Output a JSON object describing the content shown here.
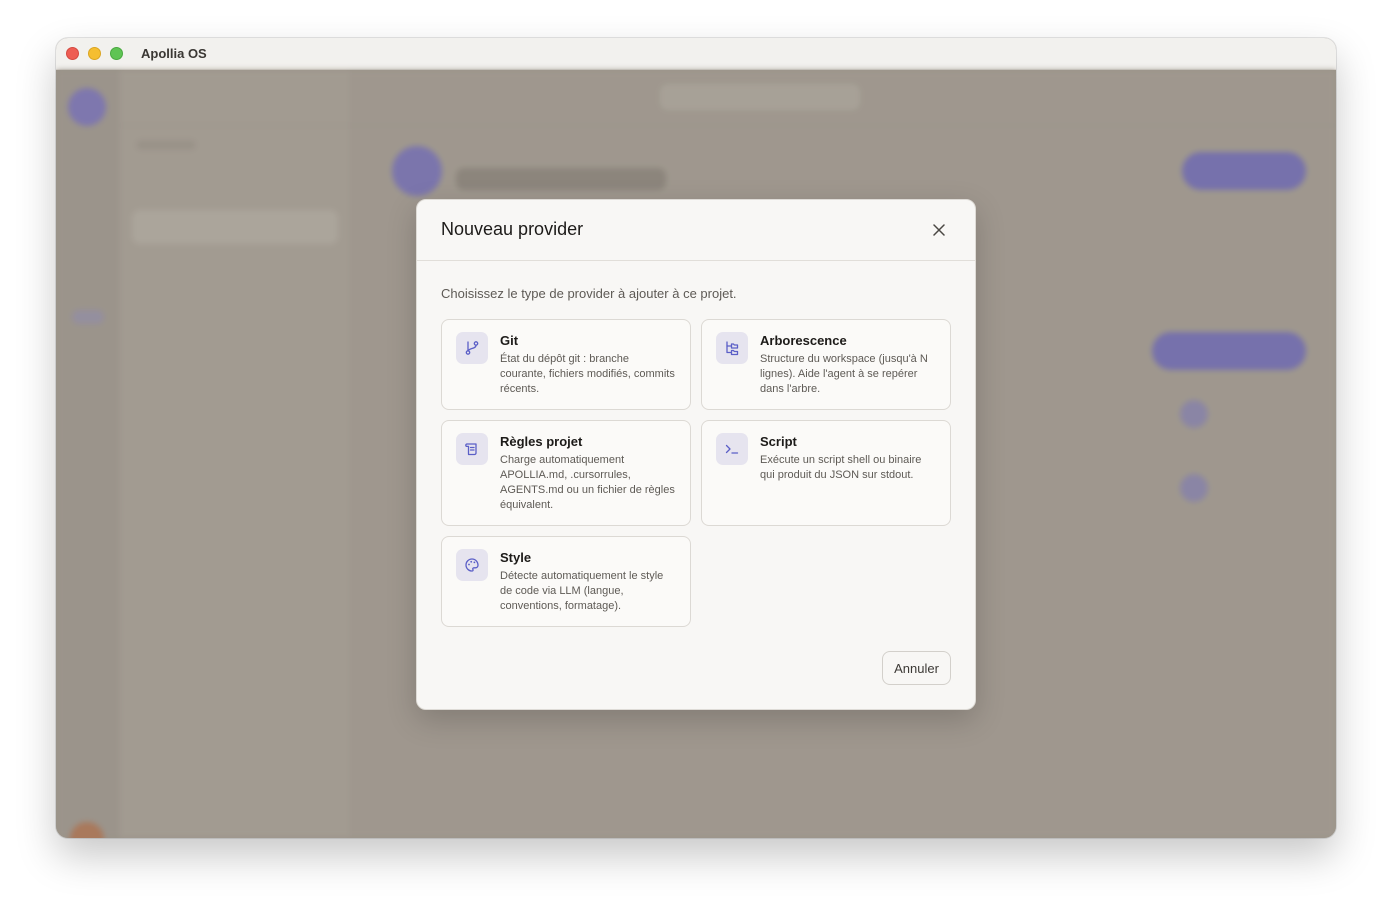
{
  "window": {
    "title": "Apollia OS"
  },
  "modal": {
    "title": "Nouveau provider",
    "intro": "Choisissez le type de provider à ajouter à ce projet.",
    "cancel_label": "Annuler",
    "accent_color": "#5b5fc7",
    "providers": [
      {
        "icon": "git-branch-icon",
        "title": "Git",
        "description": "État du dépôt git : branche courante, fichiers modifiés, commits récents."
      },
      {
        "icon": "folder-tree-icon",
        "title": "Arborescence",
        "description": "Structure du workspace (jusqu'à N lignes). Aide l'agent à se repérer dans l'arbre."
      },
      {
        "icon": "scroll-icon",
        "title": "Règles projet",
        "description": "Charge automatiquement APOLLIA.md, .cursorrules, AGENTS.md ou un fichier de règles équivalent."
      },
      {
        "icon": "terminal-icon",
        "title": "Script",
        "description": "Exécute un script shell ou binaire qui produit du JSON sur stdout."
      },
      {
        "icon": "palette-icon",
        "title": "Style",
        "description": "Détecte automatiquement le style de code via LLM (langue, conventions, formatage)."
      }
    ]
  }
}
